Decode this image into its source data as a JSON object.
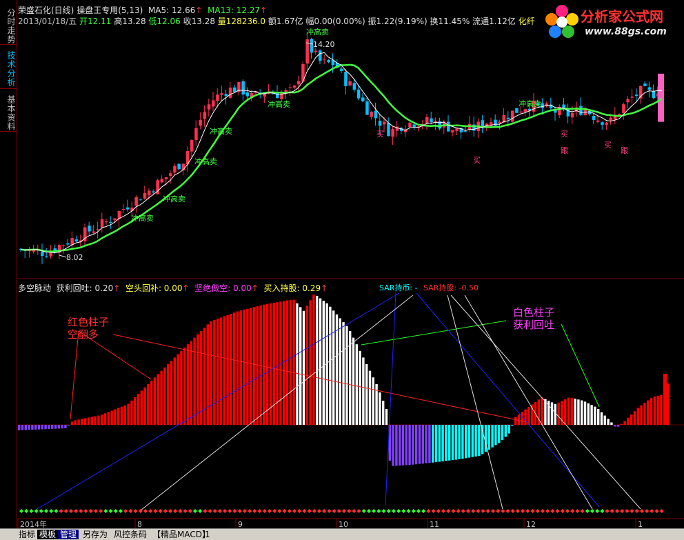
{
  "sidebar": {
    "tabs": [
      "分时走势",
      "技术分析",
      "基本资料"
    ]
  },
  "header": {
    "stock": "荣盛石化(日线)",
    "template": "操盘王专用",
    "params": "(5,13)",
    "ma5": "MA5: 12.66",
    "ma13": "MA13: 12.27",
    "date": "2013/01/18/五",
    "open": "开12.11",
    "high": "高13.28",
    "low": "低12.06",
    "close": "收13.28",
    "volume": "量128236.0",
    "amount": "额1.67亿",
    "change": "幅0.00(0.00%)",
    "amplitude": "振1.22(9.19%)",
    "turnover": "换11.45%",
    "float": "流通1.12亿",
    "sector": "化纤"
  },
  "logo": {
    "title": "分析家公式网",
    "url": "www.88gs.com"
  },
  "indicator": {
    "name": "多空脉动",
    "profit": "获利回吐: 0.20",
    "bull_fill": "空头回补: 0.00",
    "short": "坚绝做空: 0.00",
    "hold": "买入持股: 0.29",
    "sar_hold": "SAR持币: -",
    "sar_stock": "SAR持股: -0.50"
  },
  "annotations": {
    "high_label": "14.20",
    "low_label": "8.02",
    "sell_label": "冲高卖",
    "buy_label": "买",
    "follow_label": "跟",
    "red_bar_note_1": "红色柱子",
    "red_bar_note_2": "空翻多",
    "white_bar_note_1": "白色柱子",
    "white_bar_note_2": "获利回吐"
  },
  "xaxis": {
    "labels": [
      "2014年",
      "8",
      "9",
      "10",
      "11",
      "12",
      "1"
    ]
  },
  "bottombar": {
    "tabs": [
      "指标",
      "模板",
      "管理",
      "另存为",
      "风控条码",
      "【精品MACD】",
      "1"
    ]
  },
  "chart_data": {
    "type": "candlestick",
    "price_range": [
      8.02,
      14.2
    ],
    "ma_colors": {
      "ma5": "#ffffff",
      "ma13": "#40ff40"
    },
    "indicator_colors": {
      "positive": "#ff0000",
      "profit_taking": "#ffffff",
      "negative": "#8040ff",
      "recovering": "#00ffff"
    }
  }
}
